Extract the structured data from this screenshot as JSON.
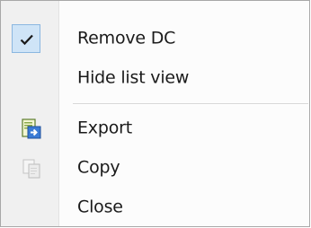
{
  "menu": {
    "items": [
      {
        "label": "Remove DC",
        "checked": true,
        "icon": "checkmark-icon"
      },
      {
        "label": "Hide list view",
        "checked": false
      },
      {
        "label": "Export",
        "icon": "export-icon"
      },
      {
        "label": "Copy",
        "icon": "copy-icon",
        "icon_disabled": true
      },
      {
        "label": "Close"
      }
    ]
  },
  "colors": {
    "check_highlight": "#cfe4f7",
    "check_border": "#8bb7e0",
    "gutter": "#f0f0f0",
    "separator": "#d7d7d7",
    "text": "#1a1a1a"
  }
}
